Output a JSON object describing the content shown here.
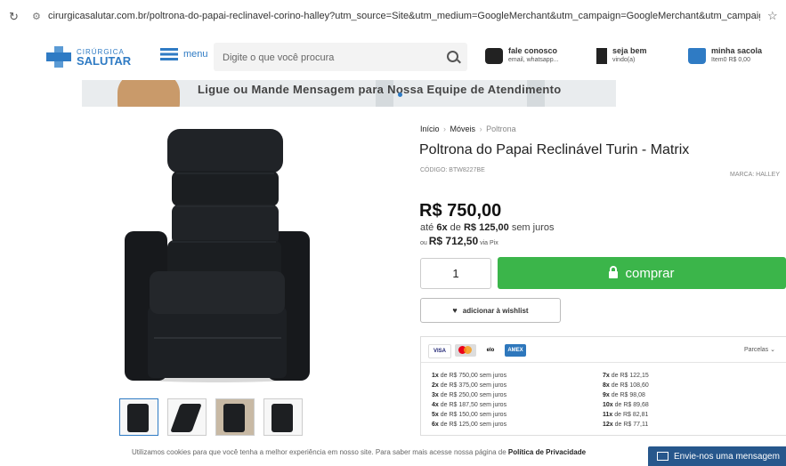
{
  "browser": {
    "url": "cirurgicasalutar.com.br/poltrona-do-papai-reclinavel-corino-halley?utm_source=Site&utm_medium=GoogleMerchant&utm_campaign=GoogleMerchant&utm_campaign=MOVEIS-PMAX&gad..."
  },
  "header": {
    "logo_small": "CIRÚRGICA",
    "logo_big": "SALUTAR",
    "menu_label": "menu",
    "search_placeholder": "Digite o que você procura",
    "contact_title": "fale conosco",
    "contact_sub": "email, whatsapp...",
    "welcome_title": "seja bem",
    "welcome_sub": "vindo(a)",
    "bag_title": "minha sacola",
    "bag_sub": "Item0 R$ 0,00"
  },
  "banner": {
    "text": "Ligue ou Mande Mensagem para Nossa Equipe de Atendimento"
  },
  "breadcrumb": {
    "home": "Início",
    "category": "Móveis",
    "current": "Poltrona",
    "sep": "›"
  },
  "product": {
    "title": "Poltrona do Papai Reclinável Turin - Matrix",
    "code": "CÓDIGO: BTW8227BE",
    "brand": "MARCA: HALLEY",
    "price": "R$ 750,00",
    "install_prefix": "até",
    "install_count": "6x",
    "install_mid": "de",
    "install_value": "R$ 125,00",
    "install_suffix": "sem juros",
    "pix_prefix": "ou",
    "pix_value": "R$ 712,50",
    "pix_suffix": "via Pix",
    "quantity": "1",
    "buy_label": "comprar",
    "wishlist_label": "adicionar à wishlist"
  },
  "payment": {
    "cards": [
      "VISA",
      "",
      "elo",
      "AMEX"
    ],
    "parcelas_label": "Parcelas",
    "left": [
      {
        "n": "1x",
        "t": "de R$ 750,00 sem juros"
      },
      {
        "n": "2x",
        "t": "de R$ 375,00 sem juros"
      },
      {
        "n": "3x",
        "t": "de R$ 250,00 sem juros"
      },
      {
        "n": "4x",
        "t": "de R$ 187,50 sem juros"
      },
      {
        "n": "5x",
        "t": "de R$ 150,00 sem juros"
      },
      {
        "n": "6x",
        "t": "de R$ 125,00 sem juros"
      }
    ],
    "right": [
      {
        "n": "7x",
        "t": "de R$ 122,15"
      },
      {
        "n": "8x",
        "t": "de R$ 108,60"
      },
      {
        "n": "9x",
        "t": "de R$ 98,08"
      },
      {
        "n": "10x",
        "t": "de R$ 89,68"
      },
      {
        "n": "11x",
        "t": "de R$ 82,81"
      },
      {
        "n": "12x",
        "t": "de R$ 77,11"
      }
    ]
  },
  "cookie": {
    "text": "Utilizamos cookies para que você tenha a melhor experiência em nosso site. Para saber mais acesse nossa página de",
    "link": "Política de Privacidade"
  },
  "chat": {
    "label": "Envie-nos uma mensagem"
  },
  "colors": {
    "brand_blue": "#2f7bc4",
    "buy_green": "#3bb54a",
    "chat_blue": "#27578c"
  }
}
